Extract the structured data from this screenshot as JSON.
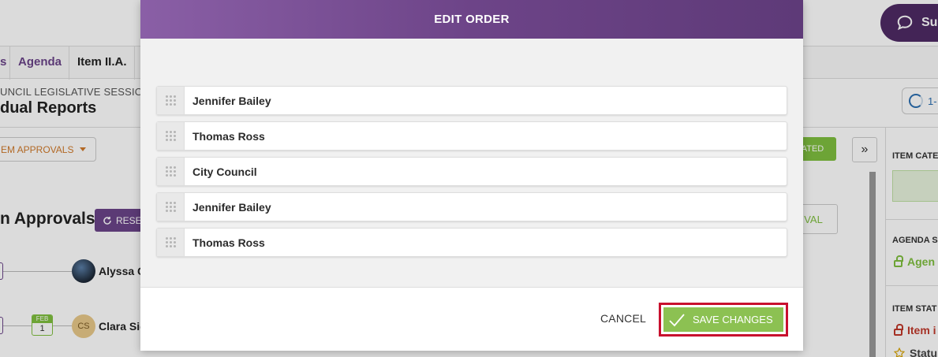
{
  "background": {
    "support_label": "Sup",
    "breadcrumbs": {
      "prev_fragment": "s",
      "agenda": "Agenda",
      "item": "Item II.A."
    },
    "session_label": "UNCIL LEGISLATIVE SESSION",
    "page_title": "dual Reports",
    "progress_label": "1-",
    "approvals_dropdown": "EM APPROVALS",
    "status_button": "ATED",
    "expand_glyph": "»",
    "section_title": "n Approvals",
    "reset_label": "RESET",
    "approval_button": "VAL",
    "approvers": [
      {
        "name": "Alyssa C"
      },
      {
        "name": "Clara Sie",
        "initials": "CS"
      }
    ],
    "date_chip": {
      "month": "FEB",
      "day": "1"
    },
    "right_panel": {
      "item_category_label": "ITEM CATE",
      "agenda_section_label": "AGENDA S",
      "agenda_value": "Agen",
      "item_status_label": "ITEM STAT",
      "item_status_value": "Item i",
      "status_value": "Statu"
    }
  },
  "modal": {
    "title": "EDIT ORDER",
    "items": [
      {
        "label": "Jennifer Bailey"
      },
      {
        "label": "Thomas Ross"
      },
      {
        "label": "City Council"
      },
      {
        "label": "Jennifer Bailey"
      },
      {
        "label": "Thomas Ross"
      }
    ],
    "cancel_label": "CANCEL",
    "save_label": "SAVE CHANGES"
  },
  "colors": {
    "brand_purple": "#6b4489",
    "save_green": "#8cc152",
    "highlight_red": "#c8102e"
  },
  "icons": [
    "chat-bubble-icon",
    "drag-handle-icon",
    "checkmark-icon",
    "refresh-icon",
    "lock-icon",
    "star-icon"
  ]
}
